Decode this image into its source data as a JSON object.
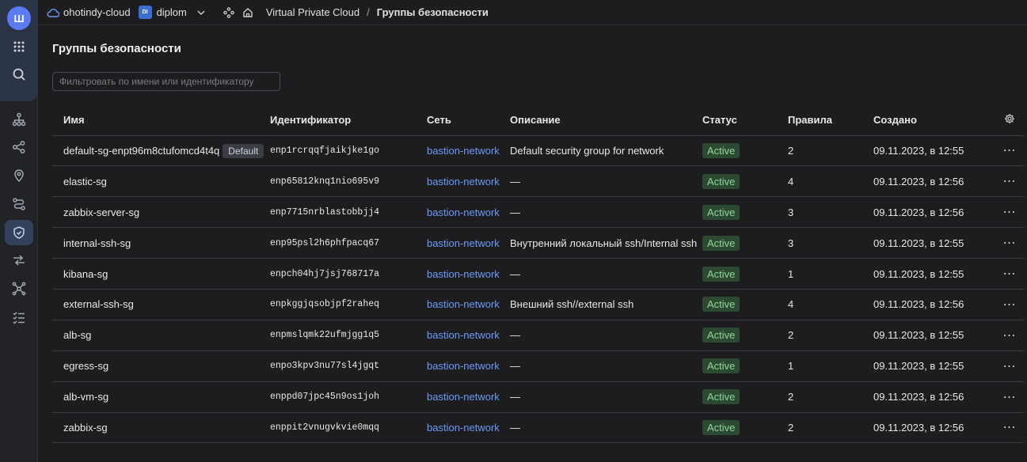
{
  "logo_letter": "Ш",
  "breadcrumb": {
    "cloud": "ohotindy-cloud",
    "folder_badge": "DI",
    "folder": "diplom",
    "service": "Virtual Private Cloud",
    "separator": "/",
    "current": "Группы безопасности"
  },
  "page": {
    "title": "Группы безопасности",
    "filter_placeholder": "Фильтровать по имени или идентификатору"
  },
  "table": {
    "headers": [
      "Имя",
      "Идентификатор",
      "Сеть",
      "Описание",
      "Статус",
      "Правила",
      "Создано"
    ],
    "rows": [
      {
        "name": "default-sg-enpt96m8ctufomcd4t4q",
        "badge": "Default",
        "id": "enp1rcrqqfjaikjke1go",
        "network": "bastion-network",
        "description": "Default security group for network",
        "status": "Active",
        "rules": "2",
        "created": "09.11.2023, в 12:55"
      },
      {
        "name": "elastic-sg",
        "badge": "",
        "id": "enp65812knq1nio695v9",
        "network": "bastion-network",
        "description": "—",
        "status": "Active",
        "rules": "4",
        "created": "09.11.2023, в 12:56"
      },
      {
        "name": "zabbix-server-sg",
        "badge": "",
        "id": "enp7715nrblastobbjj4",
        "network": "bastion-network",
        "description": "—",
        "status": "Active",
        "rules": "3",
        "created": "09.11.2023, в 12:56"
      },
      {
        "name": "internal-ssh-sg",
        "badge": "",
        "id": "enp95psl2h6phfpacq67",
        "network": "bastion-network",
        "description": "Внутренний локальный ssh/Internal ssh",
        "status": "Active",
        "rules": "3",
        "created": "09.11.2023, в 12:55"
      },
      {
        "name": "kibana-sg",
        "badge": "",
        "id": "enpch04hj7jsj768717a",
        "network": "bastion-network",
        "description": "—",
        "status": "Active",
        "rules": "1",
        "created": "09.11.2023, в 12:55"
      },
      {
        "name": "external-ssh-sg",
        "badge": "",
        "id": "enpkggjqsobjpf2raheq",
        "network": "bastion-network",
        "description": "Внешний ssh//external ssh",
        "status": "Active",
        "rules": "4",
        "created": "09.11.2023, в 12:56"
      },
      {
        "name": "alb-sg",
        "badge": "",
        "id": "enpmslqmk22ufmjgg1q5",
        "network": "bastion-network",
        "description": "—",
        "status": "Active",
        "rules": "2",
        "created": "09.11.2023, в 12:55"
      },
      {
        "name": "egress-sg",
        "badge": "",
        "id": "enpo3kpv3nu77sl4jgqt",
        "network": "bastion-network",
        "description": "—",
        "status": "Active",
        "rules": "1",
        "created": "09.11.2023, в 12:55"
      },
      {
        "name": "alb-vm-sg",
        "badge": "",
        "id": "enppd07jpc45n9os1joh",
        "network": "bastion-network",
        "description": "—",
        "status": "Active",
        "rules": "2",
        "created": "09.11.2023, в 12:56"
      },
      {
        "name": "zabbix-sg",
        "badge": "",
        "id": "enppit2vnugvkvie0mqq",
        "network": "bastion-network",
        "description": "—",
        "status": "Active",
        "rules": "2",
        "created": "09.11.2023, в 12:56"
      }
    ]
  },
  "colors": {
    "accent": "#6b9bf5",
    "status_bg": "#2c4a31",
    "status_text": "#8fd49b"
  }
}
